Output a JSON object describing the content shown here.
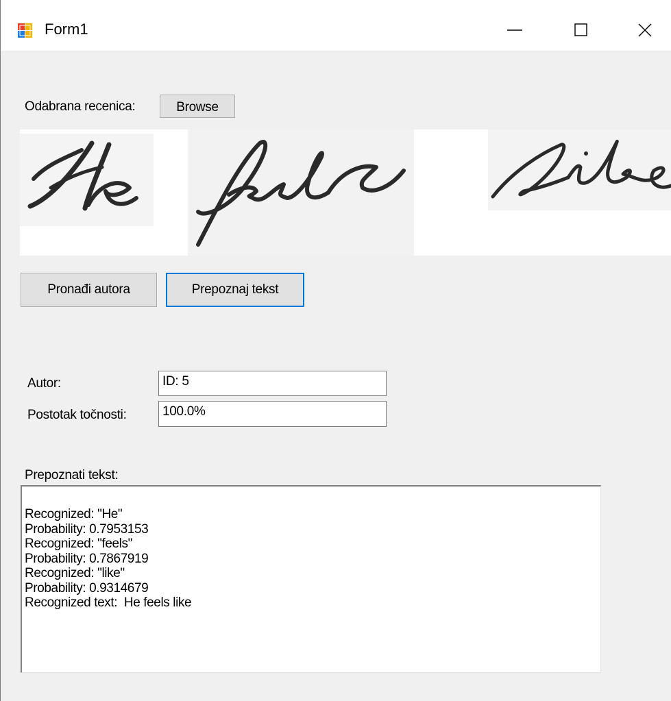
{
  "window": {
    "title": "Form1",
    "icon": "winforms-app-icon",
    "controls": [
      "minimize-icon",
      "maximize-icon",
      "close-icon"
    ]
  },
  "sentence": {
    "label": "Odabrana recenica:",
    "browse_button": "Browse",
    "image_description": "handwritten words"
  },
  "actions": {
    "find_author": "Pronađi autora",
    "recognize_text": "Prepoznaj tekst"
  },
  "author": {
    "label": "Autor:",
    "value": "ID: 5"
  },
  "accuracy": {
    "label": "Postotak točnosti:",
    "value": "100.0%"
  },
  "output": {
    "label": "Prepoznati tekst:",
    "lines": [
      "Recognized: \"He\"",
      "Probability: 0.7953153",
      "Recognized: \"feels\"",
      "Probability: 0.7867919",
      "Recognized: \"like\"",
      "Probability: 0.9314679",
      "Recognized text:  He feels like"
    ]
  },
  "colors": {
    "focus_accent": "#0078d7",
    "form_background": "#f0f0f0",
    "button_face": "#e1e1e1"
  }
}
